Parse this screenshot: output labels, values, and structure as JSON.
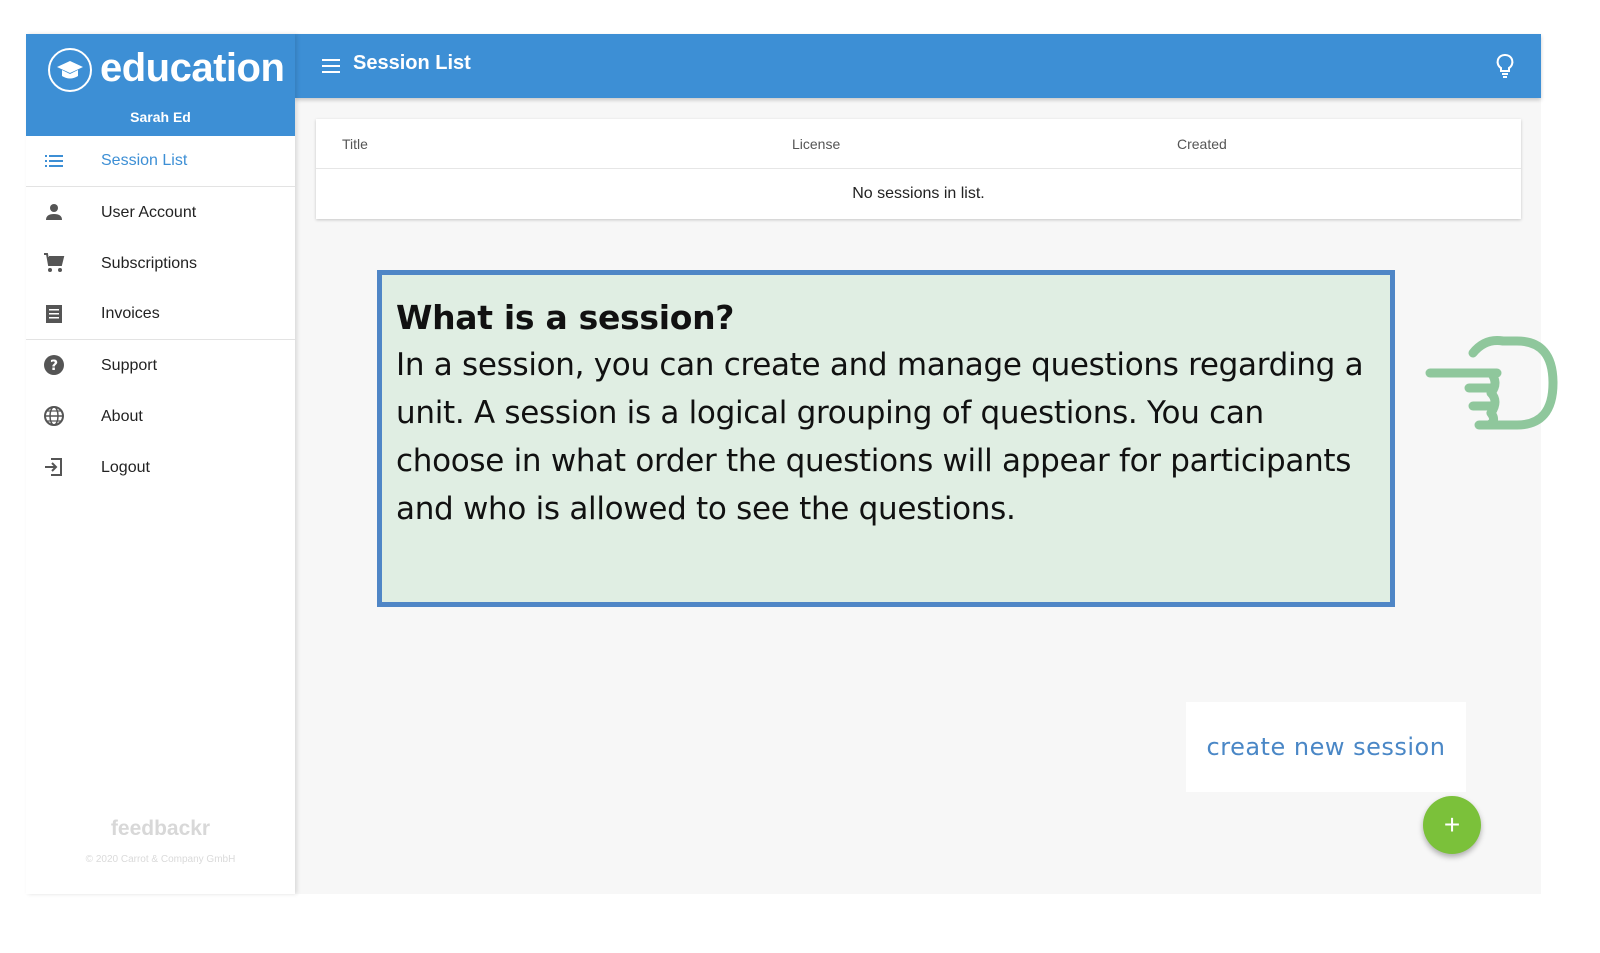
{
  "brand": {
    "name": "education",
    "user": "Sarah Ed"
  },
  "header": {
    "title": "Session List"
  },
  "sidebar": {
    "items": [
      {
        "label": "Session List",
        "icon": "list-icon",
        "active": true
      },
      {
        "label": "User Account",
        "icon": "person-icon"
      },
      {
        "label": "Subscriptions",
        "icon": "cart-icon"
      },
      {
        "label": "Invoices",
        "icon": "invoice-icon"
      },
      {
        "label": "Support",
        "icon": "help-icon"
      },
      {
        "label": "About",
        "icon": "globe-icon"
      },
      {
        "label": "Logout",
        "icon": "logout-icon"
      }
    ],
    "footer_logo": "feedbackr",
    "footer_copy": "© 2020 Carrot & Company GmbH"
  },
  "table": {
    "columns": [
      "Title",
      "License",
      "Created"
    ],
    "empty_text": "No sessions in list."
  },
  "info": {
    "title": "What is a session?",
    "text": "In a session, you can create and manage questions regarding a unit. A session is a logical grouping of questions. You can choose in what order the questions will appear for participants and who is allowed to see the questions."
  },
  "tooltip": {
    "text": "create new session"
  },
  "fab": {
    "label": "+"
  },
  "colors": {
    "primary": "#3d8fd5",
    "accent": "#7bc13a",
    "info_bg": "#e0eee3",
    "info_border": "#4f86c6"
  }
}
